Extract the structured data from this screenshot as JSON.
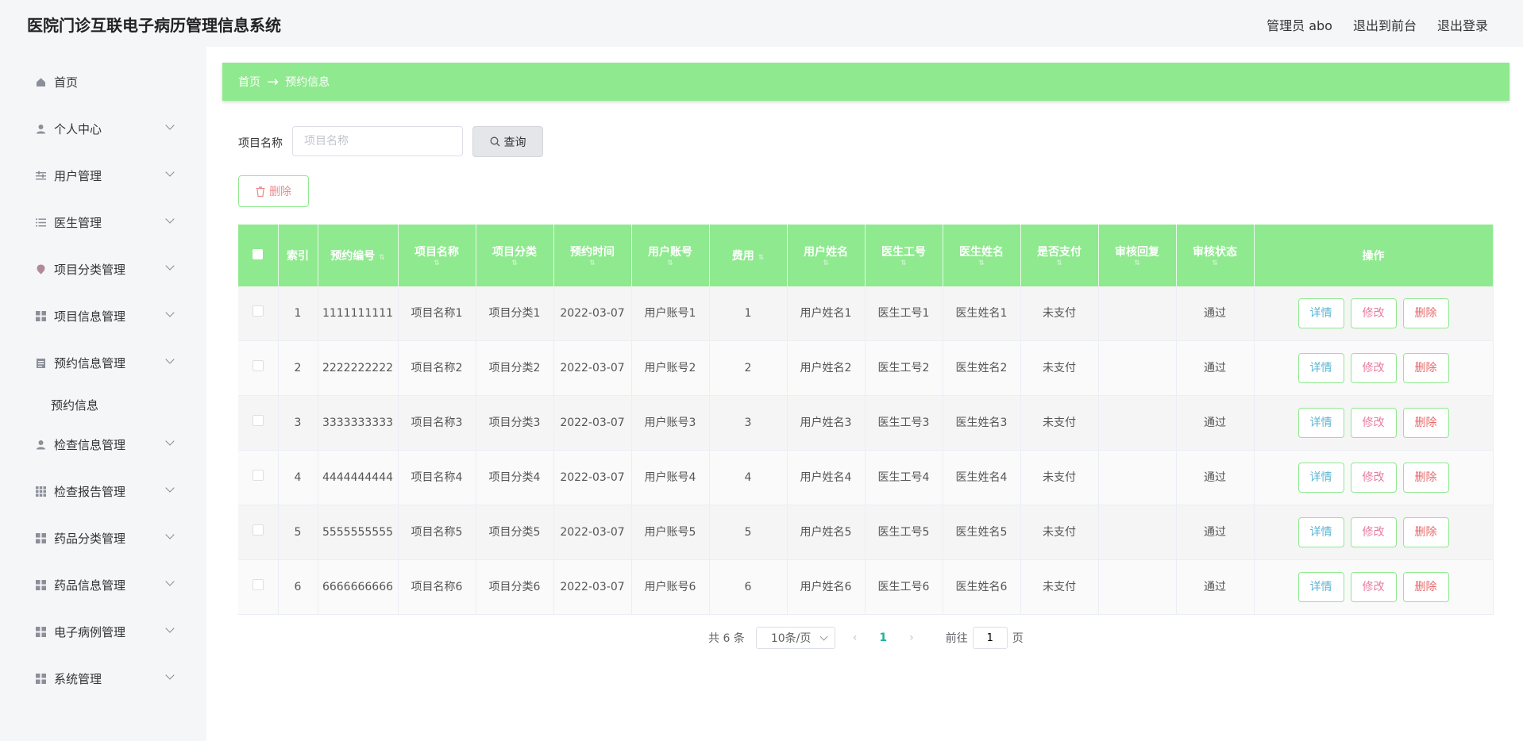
{
  "app": {
    "title": "医院门诊互联电子病历管理信息系统"
  },
  "top_links": {
    "admin": "管理员 abo",
    "to_front": "退出到前台",
    "logout": "退出登录"
  },
  "sidebar": {
    "items": [
      {
        "label": "首页",
        "icon": "home-icon"
      },
      {
        "label": "个人中心",
        "icon": "user-icon"
      },
      {
        "label": "用户管理",
        "icon": "sliders-icon"
      },
      {
        "label": "医生管理",
        "icon": "list-icon"
      },
      {
        "label": "项目分类管理",
        "icon": "pin-icon"
      },
      {
        "label": "项目信息管理",
        "icon": "grid-icon"
      },
      {
        "label": "预约信息管理",
        "icon": "clipboard-icon"
      },
      {
        "label": "检查信息管理",
        "icon": "user-icon"
      },
      {
        "label": "检查报告管理",
        "icon": "apps-icon"
      },
      {
        "label": "药品分类管理",
        "icon": "grid-icon"
      },
      {
        "label": "药品信息管理",
        "icon": "grid-icon"
      },
      {
        "label": "电子病例管理",
        "icon": "grid-icon"
      },
      {
        "label": "系统管理",
        "icon": "grid-icon"
      }
    ],
    "sub_item": "预约信息"
  },
  "breadcrumb": {
    "home": "首页",
    "current": "预约信息"
  },
  "search": {
    "label": "项目名称",
    "placeholder": "项目名称",
    "button": "查询"
  },
  "actions": {
    "delete": "删除"
  },
  "table": {
    "headers": [
      "索引",
      "预约编号",
      "项目名称",
      "项目分类",
      "预约时间",
      "用户账号",
      "费用",
      "用户姓名",
      "医生工号",
      "医生姓名",
      "是否支付",
      "审核回复",
      "审核状态",
      "操作"
    ],
    "rows": [
      {
        "index": "1",
        "code": "1111111111",
        "project": "项目名称1",
        "category": "项目分类1",
        "time": "2022-03-07",
        "account": "用户账号1",
        "fee": "1",
        "name": "用户姓名1",
        "doc_no": "医生工号1",
        "doc_name": "医生姓名1",
        "paid": "未支付",
        "reply": "",
        "status": "通过"
      },
      {
        "index": "2",
        "code": "2222222222",
        "project": "项目名称2",
        "category": "项目分类2",
        "time": "2022-03-07",
        "account": "用户账号2",
        "fee": "2",
        "name": "用户姓名2",
        "doc_no": "医生工号2",
        "doc_name": "医生姓名2",
        "paid": "未支付",
        "reply": "",
        "status": "通过"
      },
      {
        "index": "3",
        "code": "3333333333",
        "project": "项目名称3",
        "category": "项目分类3",
        "time": "2022-03-07",
        "account": "用户账号3",
        "fee": "3",
        "name": "用户姓名3",
        "doc_no": "医生工号3",
        "doc_name": "医生姓名3",
        "paid": "未支付",
        "reply": "",
        "status": "通过"
      },
      {
        "index": "4",
        "code": "4444444444",
        "project": "项目名称4",
        "category": "项目分类4",
        "time": "2022-03-07",
        "account": "用户账号4",
        "fee": "4",
        "name": "用户姓名4",
        "doc_no": "医生工号4",
        "doc_name": "医生姓名4",
        "paid": "未支付",
        "reply": "",
        "status": "通过"
      },
      {
        "index": "5",
        "code": "5555555555",
        "project": "项目名称5",
        "category": "项目分类5",
        "time": "2022-03-07",
        "account": "用户账号5",
        "fee": "5",
        "name": "用户姓名5",
        "doc_no": "医生工号5",
        "doc_name": "医生姓名5",
        "paid": "未支付",
        "reply": "",
        "status": "通过"
      },
      {
        "index": "6",
        "code": "6666666666",
        "project": "项目名称6",
        "category": "项目分类6",
        "time": "2022-03-07",
        "account": "用户账号6",
        "fee": "6",
        "name": "用户姓名6",
        "doc_no": "医生工号6",
        "doc_name": "医生姓名6",
        "paid": "未支付",
        "reply": "",
        "status": "通过"
      }
    ],
    "row_actions": {
      "detail": "详情",
      "edit": "修改",
      "delete": "删除"
    }
  },
  "pagination": {
    "total": "共 6 条",
    "page_size": "10条/页",
    "current": "1",
    "goto_label": "前往",
    "goto_value": "1",
    "page_unit": "页"
  },
  "colors": {
    "accent": "#8fe98f",
    "page_active": "#1fb19e"
  }
}
